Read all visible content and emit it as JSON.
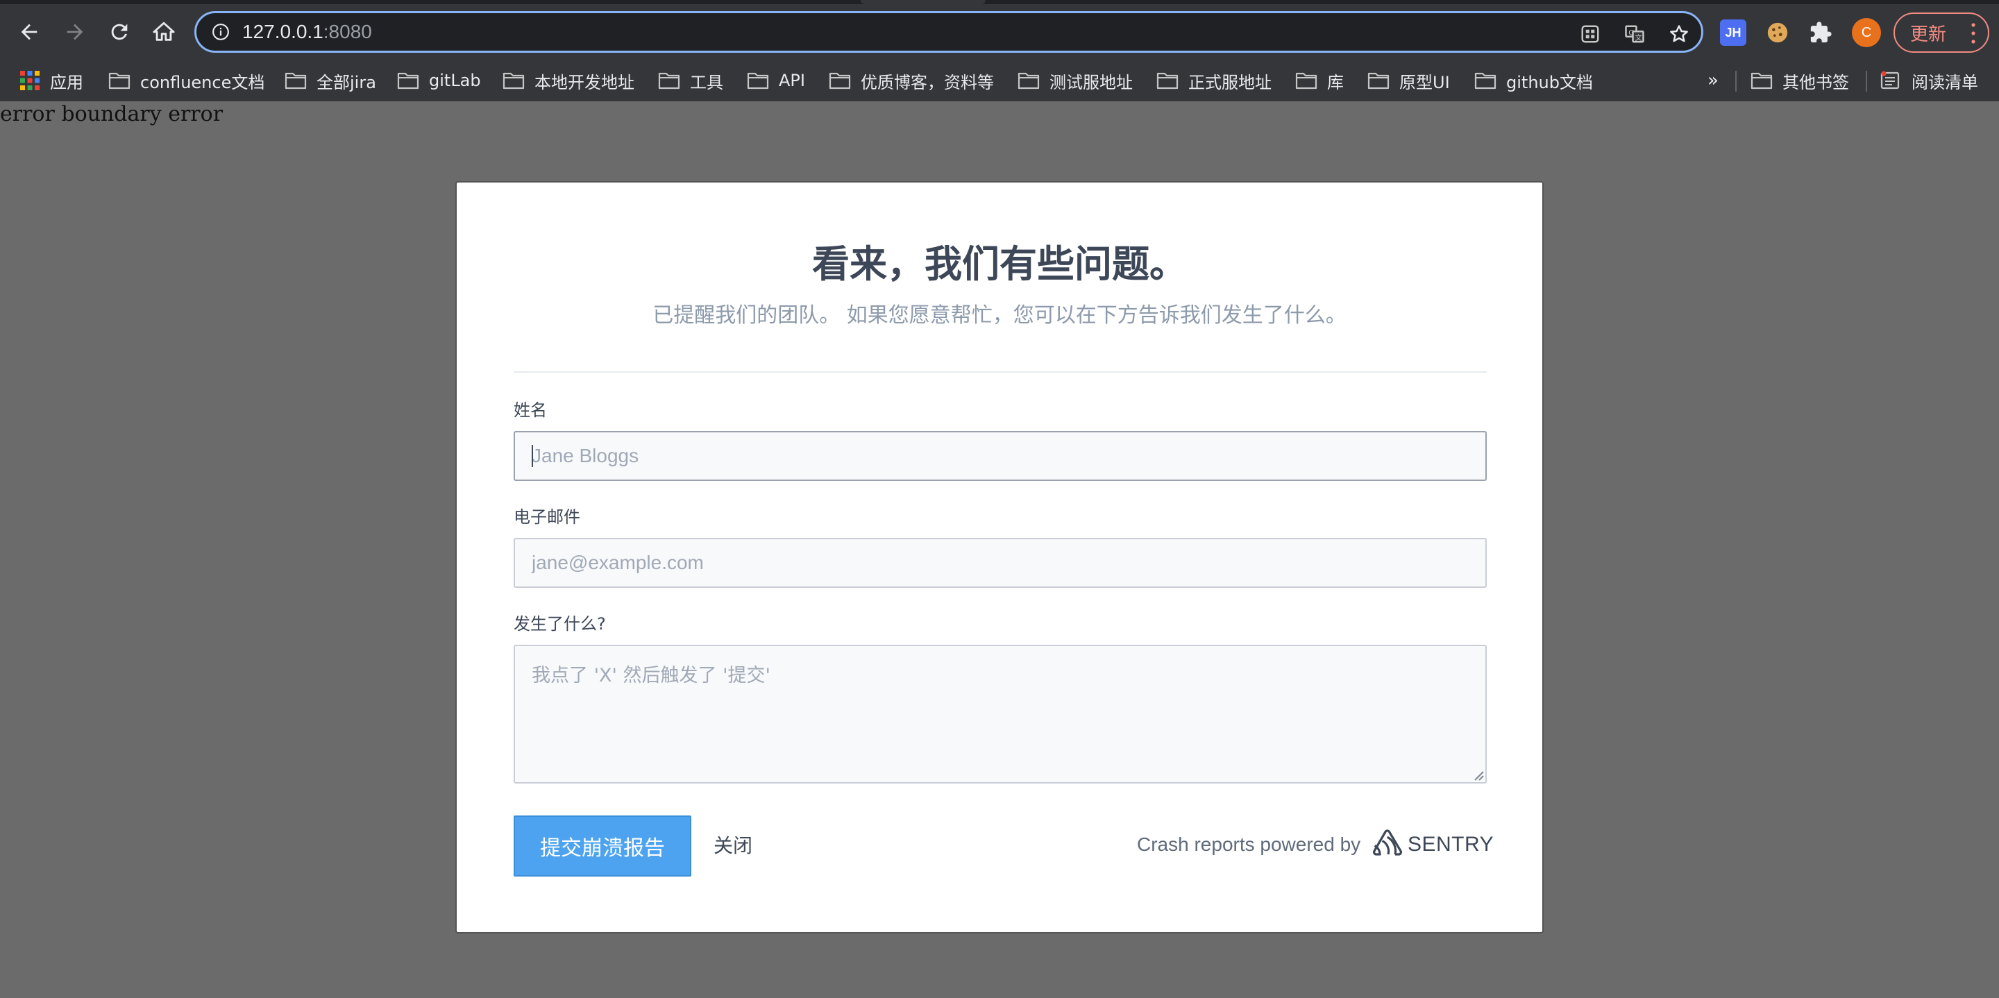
{
  "browser": {
    "url_host": "127.0.0.1",
    "url_port": ":8080",
    "update_label": "更新",
    "avatar_letter": "C",
    "ext_jh_label": "JH"
  },
  "bookmarks": {
    "items": [
      "应用",
      "confluence文档",
      "全部jira",
      "gitLab",
      "本地开发地址",
      "工具",
      "API",
      "优质博客，资料等",
      "测试服地址",
      "正式服地址",
      "库",
      "原型UI",
      "github文档"
    ],
    "overflow": "»",
    "other": "其他书签",
    "reading_list": "阅读清单"
  },
  "page": {
    "error_text": "error boundary error"
  },
  "dialog": {
    "title": "看来，我们有些问题。",
    "subtitle": "已提醒我们的团队。 如果您愿意帮忙，您可以在下方告诉我们发生了什么。",
    "name_label": "姓名",
    "name_placeholder": "Jane Bloggs",
    "email_label": "电子邮件",
    "email_placeholder": "jane@example.com",
    "comments_label": "发生了什么?",
    "comments_placeholder": "我点了 'X' 然后触发了 '提交'",
    "submit_label": "提交崩溃报告",
    "close_label": "关闭",
    "powered_by": "Crash reports powered by",
    "sentry_word": "SENTRY"
  },
  "colors": {
    "overlay": "#6b6b6b",
    "primary_button": "#4da3f0",
    "title_text": "#3d4757",
    "subtitle_text": "#8d9aab"
  }
}
